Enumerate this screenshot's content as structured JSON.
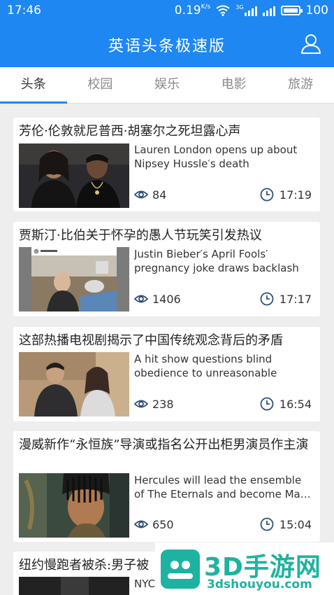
{
  "status": {
    "time": "17:46",
    "speed": "0.19",
    "speed_unit": "K/s",
    "network": "3G",
    "battery": "100"
  },
  "header": {
    "title": "英语头条极速版",
    "user_icon": "user-icon"
  },
  "tabs": [
    {
      "label": "头条",
      "active": true
    },
    {
      "label": "校园",
      "active": false
    },
    {
      "label": "娱乐",
      "active": false
    },
    {
      "label": "电影",
      "active": false
    },
    {
      "label": "旅游",
      "active": false
    }
  ],
  "articles": [
    {
      "headline": "芳伦·伦敦就尼普西·胡塞尔之死坦露心声",
      "summary": "Lauren London opens up about\nNipsey Hussle′s death",
      "views": "84",
      "time": "17:19"
    },
    {
      "headline": "贾斯汀·比伯关于怀孕的愚人节玩笑引发热议",
      "summary": "Justin Bieber′s April Fools′\npregnancy joke draws backlash",
      "views": "1406",
      "time": "17:17"
    },
    {
      "headline": "这部热播电视剧揭示了中国传统观念背后的矛盾",
      "summary": "A hit show questions blind\nobedience to unreasonable parents",
      "views": "238",
      "time": "16:54"
    },
    {
      "headline": "漫威新作“永恒族”导演或指名公开出柜男演员作主演",
      "summary": "Hercules will lead the ensemble\nof The Eternals and become Ma…",
      "views": "650",
      "time": "15:04"
    },
    {
      "headline": "纽约慢跑者被杀:男子被",
      "summary": "NYC",
      "views": "",
      "time": ""
    }
  ],
  "watermark": {
    "brand": "3D手游网",
    "domain": "3dshouyou.com"
  },
  "colors": {
    "primary": "#1f87f1",
    "watermark": "#1eb3a0"
  }
}
